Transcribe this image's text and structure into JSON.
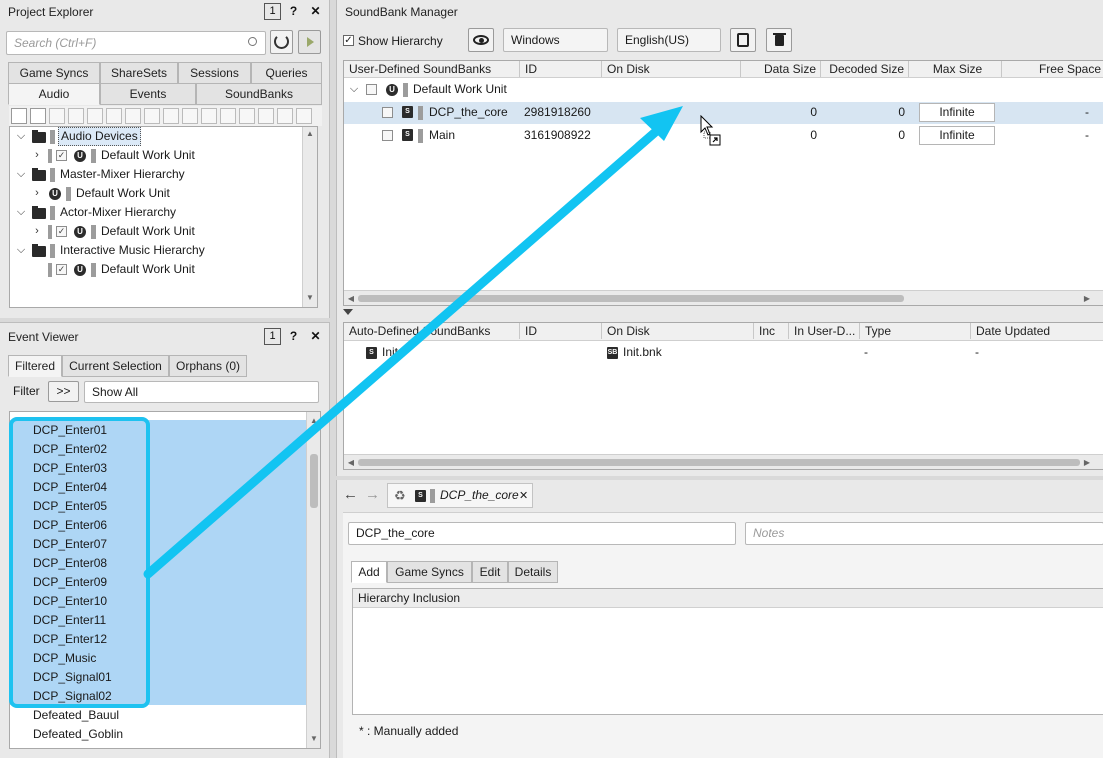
{
  "project_explorer": {
    "title": "Project Explorer",
    "badge": "1",
    "help": "?",
    "close": "✕",
    "search_placeholder": "Search (Ctrl+F)",
    "tabs_row1": [
      "Game Syncs",
      "ShareSets",
      "Sessions",
      "Queries"
    ],
    "tabs_row2": [
      "Audio",
      "Events",
      "SoundBanks"
    ],
    "tree": [
      {
        "label": "Audio Devices",
        "level": 0
      },
      {
        "label": "Default Work Unit",
        "level": 1
      },
      {
        "label": "Master-Mixer Hierarchy",
        "level": 0
      },
      {
        "label": "Default Work Unit",
        "level": 1
      },
      {
        "label": "Actor-Mixer Hierarchy",
        "level": 0
      },
      {
        "label": "Default Work Unit",
        "level": 1
      },
      {
        "label": "Interactive Music Hierarchy",
        "level": 0
      },
      {
        "label": "Default Work Unit",
        "level": 1
      }
    ]
  },
  "event_viewer": {
    "title": "Event Viewer",
    "badge": "1",
    "help": "?",
    "close": "✕",
    "tabs": [
      "Filtered",
      "Current Selection",
      "Orphans (0)"
    ],
    "filter_label": "Filter",
    "filter_button": ">>",
    "filter_value": "Show All",
    "events": [
      "DCP_Enter01",
      "DCP_Enter02",
      "DCP_Enter03",
      "DCP_Enter04",
      "DCP_Enter05",
      "DCP_Enter06",
      "DCP_Enter07",
      "DCP_Enter08",
      "DCP_Enter09",
      "DCP_Enter10",
      "DCP_Enter11",
      "DCP_Enter12",
      "DCP_Music",
      "DCP_Signal01",
      "DCP_Signal02",
      "Defeated_Bauul",
      "Defeated_Goblin"
    ]
  },
  "soundbank_manager": {
    "title": "SoundBank Manager",
    "show_hierarchy": "Show Hierarchy",
    "platform": "Windows",
    "language": "English(US)",
    "user_columns": [
      "User-Defined SoundBanks",
      "ID",
      "On Disk",
      "Data Size",
      "Decoded Size",
      "Max Size",
      "Free Space"
    ],
    "work_unit": "Default Work Unit",
    "banks": [
      {
        "name": "DCP_the_core",
        "id": "2981918260",
        "data_size": "0",
        "decoded_size": "0",
        "max_size": "Infinite",
        "free_space": "-"
      },
      {
        "name": "Main",
        "id": "3161908922",
        "data_size": "0",
        "decoded_size": "0",
        "max_size": "Infinite",
        "free_space": "-"
      }
    ],
    "auto_columns": [
      "Auto-Defined SoundBanks",
      "ID",
      "On Disk",
      "Inc",
      "In User-D...",
      "Type",
      "Date Updated"
    ],
    "auto_banks": [
      {
        "name": "Init",
        "on_disk": "Init.bnk",
        "type": "-",
        "date_updated": "-"
      }
    ]
  },
  "editor": {
    "tab_label": "DCP_the_core",
    "tab_close": "✕",
    "name_value": "DCP_the_core",
    "notes_placeholder": "Notes",
    "tabs": [
      "Add",
      "Game Syncs",
      "Edit",
      "Details"
    ],
    "list_header": "Hierarchy Inclusion",
    "footnote": "* : Manually added"
  },
  "colors": {
    "highlight_border": "#1ec2f0",
    "arrow": "#12c4f2",
    "selection": "#aed6f5"
  }
}
